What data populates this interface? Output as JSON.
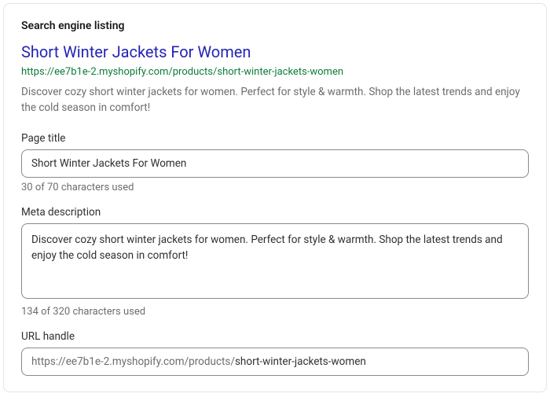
{
  "section_title": "Search engine listing",
  "preview": {
    "title": "Short Winter Jackets For Women",
    "url": "https://ee7b1e-2.myshopify.com/products/short-winter-jackets-women",
    "description": "Discover cozy short winter jackets for women. Perfect for style & warmth. Shop the latest trends and enjoy the cold season in comfort!"
  },
  "fields": {
    "page_title": {
      "label": "Page title",
      "value": "Short Winter Jackets For Women",
      "counter": "30 of 70 characters used"
    },
    "meta_description": {
      "label": "Meta description",
      "value": "Discover cozy short winter jackets for women. Perfect for style & warmth. Shop the latest trends and enjoy the cold season in comfort!",
      "counter": "134 of 320 characters used"
    },
    "url_handle": {
      "label": "URL handle",
      "prefix": "https://ee7b1e-2.myshopify.com/products/",
      "value": "short-winter-jackets-women"
    }
  }
}
